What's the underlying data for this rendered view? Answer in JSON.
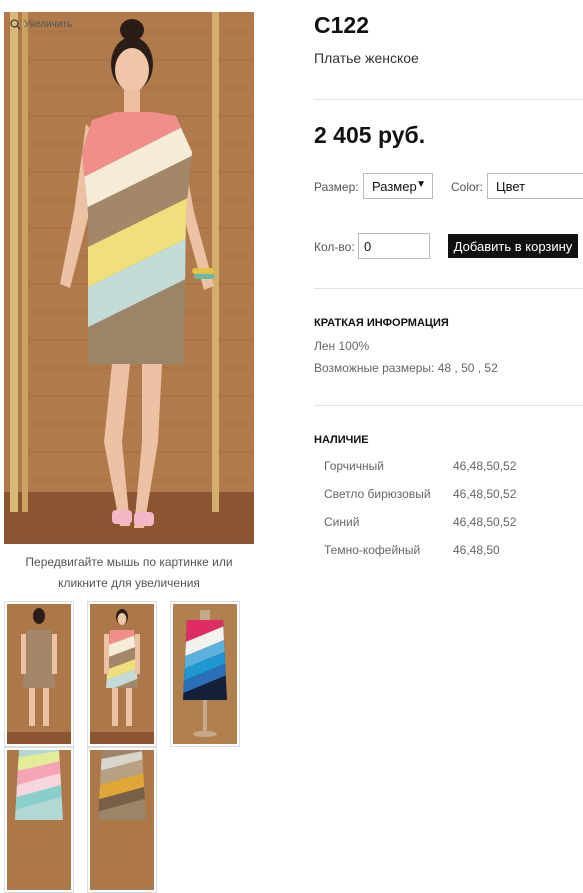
{
  "gallery": {
    "zoom_label": "Увеличить",
    "caption": "Передвигайте мышь по картинке или кликните для увеличения",
    "thumbnails": [
      {
        "name": "back-view"
      },
      {
        "name": "front-view"
      },
      {
        "name": "mannequin-red-blue"
      },
      {
        "name": "fabric-pastel"
      },
      {
        "name": "fabric-mustard"
      }
    ]
  },
  "product": {
    "code": "С122",
    "subtitle": "Платье женское",
    "price": "2 405 руб."
  },
  "options": {
    "size_label": "Размер:",
    "size_value": "Размер",
    "color_label": "Color:",
    "color_value": "Цвет",
    "qty_label": "Кол-во:",
    "qty_value": "0",
    "add_to_cart": "Добавить в корзину"
  },
  "summary": {
    "heading": "КРАТКАЯ ИНФОРМАЦИЯ",
    "lines": [
      "Лен 100%",
      "Возможные размеры: 48 , 50 , 52"
    ]
  },
  "availability": {
    "heading": "НАЛИЧИЕ",
    "rows": [
      {
        "color": "Горчичный",
        "sizes": "46,48,50,52"
      },
      {
        "color": "Светло бирюзовый",
        "sizes": "46,48,50,52"
      },
      {
        "color": "Синий",
        "sizes": "46,48,50,52"
      },
      {
        "color": "Темно-кофейный",
        "sizes": "46,48,50"
      }
    ]
  }
}
